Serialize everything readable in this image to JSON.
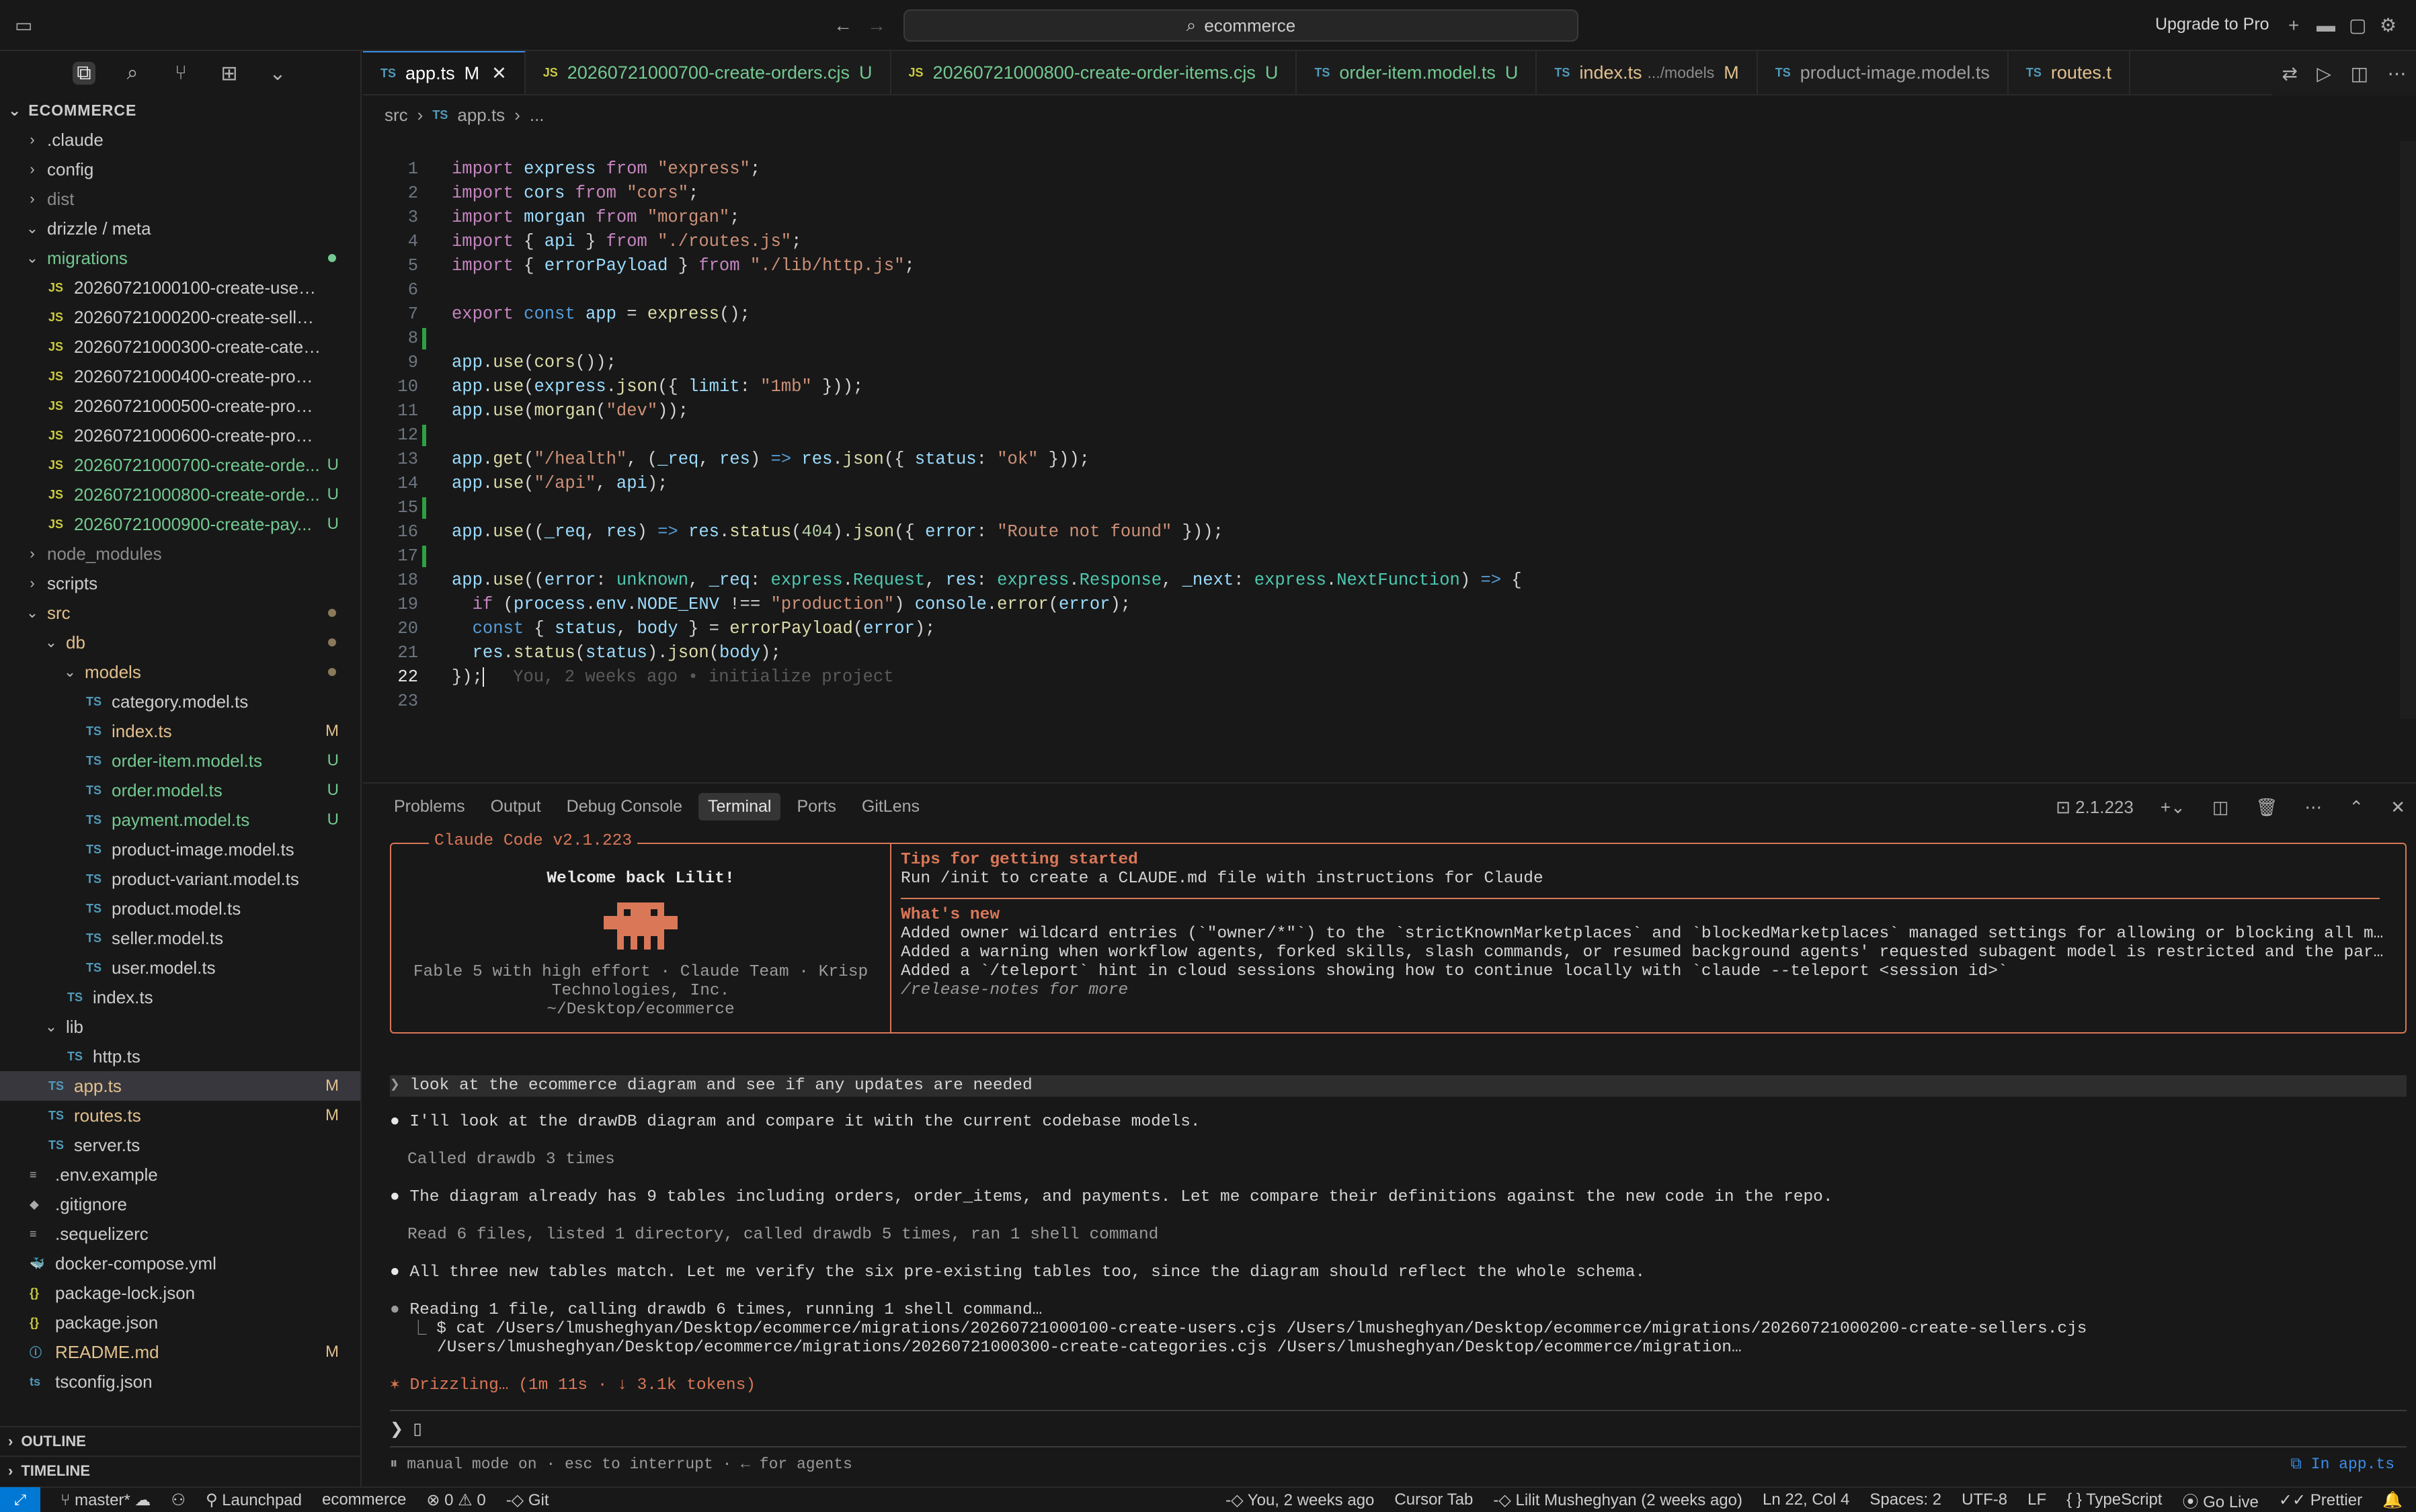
{
  "titlebar": {
    "search_text": "ecommerce",
    "upgrade_label": "Upgrade to Pro"
  },
  "explorer": {
    "title": "ECOMMERCE",
    "rows": [
      {
        "label": ".claude",
        "depth": 0,
        "kind": "folder",
        "open": false,
        "color": "#cccccc"
      },
      {
        "label": "config",
        "depth": 0,
        "kind": "folder",
        "open": false,
        "color": "#cccccc"
      },
      {
        "label": "dist",
        "depth": 0,
        "kind": "folder",
        "open": false,
        "color": "#8b8b8b"
      },
      {
        "label": "drizzle / meta",
        "depth": 0,
        "kind": "folder",
        "open": true,
        "color": "#cccccc"
      },
      {
        "label": "migrations",
        "depth": 0,
        "kind": "folder",
        "open": true,
        "color": "#73c991",
        "dot": "#73c991"
      },
      {
        "label": "20260721000100-create-users.cjs",
        "depth": 1,
        "kind": "js",
        "color": "#cccccc"
      },
      {
        "label": "20260721000200-create-sellers.cjs",
        "depth": 1,
        "kind": "js",
        "color": "#cccccc"
      },
      {
        "label": "20260721000300-create-categorie...",
        "depth": 1,
        "kind": "js",
        "color": "#cccccc"
      },
      {
        "label": "20260721000400-create-products....",
        "depth": 1,
        "kind": "js",
        "color": "#cccccc"
      },
      {
        "label": "20260721000500-create-product-...",
        "depth": 1,
        "kind": "js",
        "color": "#cccccc"
      },
      {
        "label": "20260721000600-create-product-i...",
        "depth": 1,
        "kind": "js",
        "color": "#cccccc"
      },
      {
        "label": "20260721000700-create-orde...",
        "depth": 1,
        "kind": "js",
        "color": "#73c991",
        "badge": "U"
      },
      {
        "label": "20260721000800-create-orde...",
        "depth": 1,
        "kind": "js",
        "color": "#73c991",
        "badge": "U"
      },
      {
        "label": "20260721000900-create-pay...",
        "depth": 1,
        "kind": "js",
        "color": "#73c991",
        "badge": "U"
      },
      {
        "label": "node_modules",
        "depth": 0,
        "kind": "folder",
        "open": false,
        "color": "#8b8b8b"
      },
      {
        "label": "scripts",
        "depth": 0,
        "kind": "folder",
        "open": false,
        "color": "#cccccc"
      },
      {
        "label": "src",
        "depth": 0,
        "kind": "folder",
        "open": true,
        "color": "#e2c08d",
        "dot": "#8a7a5a"
      },
      {
        "label": "db",
        "depth": 1,
        "kind": "folder",
        "open": true,
        "color": "#e2c08d",
        "dot": "#8a7a5a"
      },
      {
        "label": "models",
        "depth": 2,
        "kind": "folder",
        "open": true,
        "color": "#e2c08d",
        "dot": "#8a7a5a"
      },
      {
        "label": "category.model.ts",
        "depth": 3,
        "kind": "ts",
        "color": "#cccccc"
      },
      {
        "label": "index.ts",
        "depth": 3,
        "kind": "ts",
        "color": "#e2c08d",
        "badge": "M"
      },
      {
        "label": "order-item.model.ts",
        "depth": 3,
        "kind": "ts",
        "color": "#73c991",
        "badge": "U"
      },
      {
        "label": "order.model.ts",
        "depth": 3,
        "kind": "ts",
        "color": "#73c991",
        "badge": "U"
      },
      {
        "label": "payment.model.ts",
        "depth": 3,
        "kind": "ts",
        "color": "#73c991",
        "badge": "U"
      },
      {
        "label": "product-image.model.ts",
        "depth": 3,
        "kind": "ts",
        "color": "#cccccc"
      },
      {
        "label": "product-variant.model.ts",
        "depth": 3,
        "kind": "ts",
        "color": "#cccccc"
      },
      {
        "label": "product.model.ts",
        "depth": 3,
        "kind": "ts",
        "color": "#cccccc"
      },
      {
        "label": "seller.model.ts",
        "depth": 3,
        "kind": "ts",
        "color": "#cccccc"
      },
      {
        "label": "user.model.ts",
        "depth": 3,
        "kind": "ts",
        "color": "#cccccc"
      },
      {
        "label": "index.ts",
        "depth": 2,
        "kind": "ts",
        "color": "#cccccc"
      },
      {
        "label": "lib",
        "depth": 1,
        "kind": "folder",
        "open": true,
        "color": "#cccccc"
      },
      {
        "label": "http.ts",
        "depth": 2,
        "kind": "ts",
        "color": "#cccccc"
      },
      {
        "label": "app.ts",
        "depth": 1,
        "kind": "ts",
        "color": "#e2c08d",
        "badge": "M",
        "selected": true
      },
      {
        "label": "routes.ts",
        "depth": 1,
        "kind": "ts",
        "color": "#e2c08d",
        "badge": "M"
      },
      {
        "label": "server.ts",
        "depth": 1,
        "kind": "ts",
        "color": "#cccccc"
      },
      {
        "label": ".env.example",
        "depth": 0,
        "kind": "env",
        "color": "#cccccc"
      },
      {
        "label": ".gitignore",
        "depth": 0,
        "kind": "git",
        "color": "#cccccc"
      },
      {
        "label": ".sequelizerc",
        "depth": 0,
        "kind": "cfg",
        "color": "#cccccc"
      },
      {
        "label": "docker-compose.yml",
        "depth": 0,
        "kind": "docker",
        "color": "#cccccc"
      },
      {
        "label": "package-lock.json",
        "depth": 0,
        "kind": "json",
        "color": "#cccccc"
      },
      {
        "label": "package.json",
        "depth": 0,
        "kind": "json",
        "color": "#cccccc"
      },
      {
        "label": "README.md",
        "depth": 0,
        "kind": "md",
        "color": "#e2c08d",
        "badge": "M"
      },
      {
        "label": "tsconfig.json",
        "depth": 0,
        "kind": "tsjson",
        "color": "#cccccc"
      }
    ],
    "outline_label": "OUTLINE",
    "timeline_label": "TIMELINE"
  },
  "tabs": [
    {
      "label": "app.ts",
      "type": "TS",
      "badge": "M",
      "active": true,
      "color": "#ffffff"
    },
    {
      "label": "20260721000700-create-orders.cjs",
      "type": "JS",
      "badge": "U",
      "color": "#73c991"
    },
    {
      "label": "20260721000800-create-order-items.cjs",
      "type": "JS",
      "badge": "U",
      "color": "#73c991"
    },
    {
      "label": "order-item.model.ts",
      "type": "TS",
      "badge": "U",
      "color": "#73c991"
    },
    {
      "label": "index.ts",
      "type": "TS",
      "hint": ".../models",
      "badge": "M",
      "color": "#e2c08d"
    },
    {
      "label": "product-image.model.ts",
      "type": "TS",
      "color": "#9d9d9d"
    },
    {
      "label": "routes.t",
      "type": "TS",
      "color": "#e2c08d"
    }
  ],
  "breadcrumb": {
    "parts": [
      "src",
      "app.ts",
      "..."
    ]
  },
  "code": {
    "current_line": 22,
    "blame": "You, 2 weeks ago • initialize project",
    "changed_lines": [
      8,
      12,
      15,
      17
    ]
  },
  "panel": {
    "tabs": [
      "Problems",
      "Output",
      "Debug Console",
      "Terminal",
      "Ports",
      "GitLens"
    ],
    "active_tab": "Terminal",
    "terminal_name": "2.1.223"
  },
  "claude": {
    "box_title": "Claude Code v2.1.223",
    "welcome": "Welcome back Lilit!",
    "model_line1": "Fable 5 with high effort · Claude Team · Krisp",
    "model_line2": "Technologies, Inc.",
    "cwd": "~/Desktop/ecommerce",
    "tips_title": "Tips for getting started",
    "tips_text": "Run /init to create a CLAUDE.md file with instructions for Claude",
    "whats_new_title": "What's new",
    "news": [
      "Added owner wildcard entries (`\"owner/*\"`) to the `strictKnownMarketplaces` and `blockedMarketplaces` managed settings for allowing or blocking all marketp…",
      "Added a warning when workflow agents, forked skills, slash commands, or resumed background agents' requested subagent model is restricted and the parent mo…",
      "Added a `/teleport` hint in cloud sessions showing how to continue locally with `claude --teleport <session id>`"
    ],
    "release_notes": "/release-notes for more",
    "user_prompt": "look at the ecommerce diagram and see if any updates are needed",
    "msg1": "I'll look at the drawDB diagram and compare it with the current codebase models.",
    "tool1": "Called drawdb 3 times",
    "msg2": "The diagram already has 9 tables including orders, order_items, and payments. Let me compare their definitions against the new code in the repo.",
    "tool2": "Read 6 files, listed 1 directory, called drawdb 5 times, ran 1 shell command",
    "msg3": "All three new tables match. Let me verify the six pre-existing tables too, since the diagram should reflect the whole schema.",
    "msg4": "Reading 1 file, calling drawdb 6 times, running 1 shell command…",
    "cmd1": "$ cat /Users/lmusheghyan/Desktop/ecommerce/migrations/20260721000100-create-users.cjs /Users/lmusheghyan/Desktop/ecommerce/migrations/20260721000200-create-sellers.cjs",
    "cmd2": "/Users/lmusheghyan/Desktop/ecommerce/migrations/20260721000300-create-categories.cjs /Users/lmusheghyan/Desktop/ecommerce/migration…",
    "status": "✶ Drizzling… (1m 11s · ↓ 3.1k tokens)",
    "footer": "⏸ manual mode on · esc to interrupt · ← for agents",
    "in_file": "⧉ In app.ts"
  },
  "statusbar": {
    "branch": "master*",
    "launchpad": "Launchpad",
    "workspace": "ecommerce",
    "problems": "⊗ 0 ⚠ 0",
    "git": "Git",
    "blame": "You, 2 weeks ago",
    "cursor_tab": "Cursor Tab",
    "author": "Lilit Musheghyan (2 weeks ago)",
    "position": "Ln 22, Col 4",
    "spaces": "Spaces: 2",
    "encoding": "UTF-8",
    "eol": "LF",
    "language": "{ } TypeScript",
    "golive": "Go Live",
    "prettier": "Prettier"
  },
  "colors": {
    "accent": "#0078d4",
    "claude": "#d97757",
    "untracked": "#73c991",
    "modified": "#e2c08d"
  }
}
